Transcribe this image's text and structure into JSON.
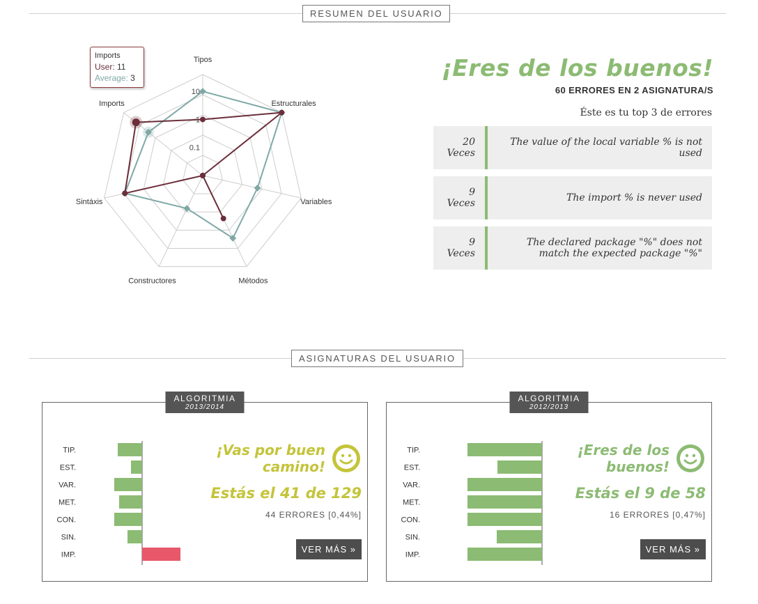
{
  "sections": {
    "summary_title": "RESUMEN DEL USUARIO",
    "subjects_title": "ASIGNATURAS DEL USUARIO"
  },
  "tooltip": {
    "category": "Imports",
    "user_label": "User:",
    "user_value": "11",
    "avg_label": "Average:",
    "avg_value": "3"
  },
  "headline": "¡Eres de los buenos!",
  "summary": "60 ERRORES EN 2 ASIGNATURA/S",
  "top3_label": "Éste es tu top 3 de errores",
  "top_errors": [
    {
      "count": "20",
      "unit": "Veces",
      "message": "The value of the local variable % is not used"
    },
    {
      "count": "9",
      "unit": "Veces",
      "message": "The import % is never used"
    },
    {
      "count": "9",
      "unit": "Veces",
      "message": "The declared package \"%\" does not match the expected package \"%\""
    }
  ],
  "chart_data": [
    {
      "type": "radar",
      "scale": "log",
      "ticks": [
        "0.1",
        "1",
        "10"
      ],
      "axes": [
        "Tipos",
        "Estructurales",
        "Variables",
        "Métodos",
        "Constructores",
        "Sintáxis",
        "Imports"
      ],
      "series": [
        {
          "name": "User",
          "values": [
            1,
            40,
            0,
            0.5,
            0,
            7,
            11
          ],
          "color": "#6b2e3a"
        },
        {
          "name": "Average",
          "values": [
            10,
            40,
            1,
            3,
            0.2,
            7,
            3
          ],
          "color": "#7fa9a6"
        }
      ]
    },
    {
      "type": "bar",
      "orientation": "horizontal-diverging",
      "categories": [
        "TIP.",
        "EST.",
        "VAR.",
        "MET.",
        "CON.",
        "SIN.",
        "IMP."
      ],
      "values": [
        -35,
        -16,
        -40,
        -33,
        -40,
        -21,
        55
      ],
      "colors": {
        "negative": "#8cbb73",
        "positive": "#e8586b"
      }
    },
    {
      "type": "bar",
      "orientation": "horizontal-diverging",
      "categories": [
        "TIP.",
        "EST.",
        "VAR.",
        "MET.",
        "CON.",
        "SIN.",
        "IMP."
      ],
      "values": [
        -107,
        -64,
        -107,
        -107,
        -107,
        -65,
        -107
      ],
      "colors": {
        "negative": "#8cbb73",
        "positive": "#e8586b"
      }
    }
  ],
  "subjects": [
    {
      "name": "ALGORITMIA",
      "year": "2013/2014",
      "message": "¡Vas por buen camino!",
      "rank": "Estás el 41 de 129",
      "errors": "44 ERRORES [0,44%]",
      "button": "VER MÁS »",
      "color": "#c4c43b"
    },
    {
      "name": "ALGORITMIA",
      "year": "2012/2013",
      "message": "¡Eres de los buenos!",
      "rank": "Estás el 9 de 58",
      "errors": "16 ERRORES [0,47%]",
      "button": "VER MÁS »",
      "color": "#8cbb73"
    }
  ]
}
